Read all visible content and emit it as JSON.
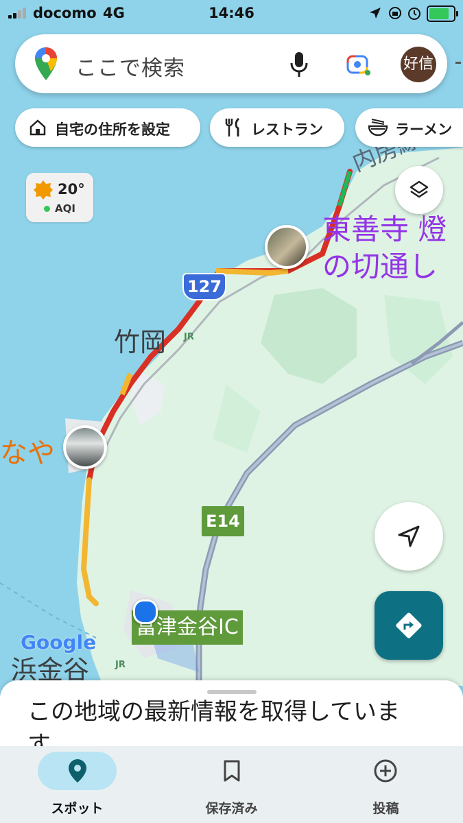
{
  "status_bar": {
    "carrier": "docomo",
    "network": "4G",
    "time": "14:46"
  },
  "search": {
    "placeholder": "ここで検索",
    "avatar_text": "好信"
  },
  "chips": [
    {
      "label": "自宅の住所を設定",
      "icon": "home-icon"
    },
    {
      "label": "レストラン",
      "icon": "restaurant-icon"
    },
    {
      "label": "ラーメン",
      "icon": "ramen-icon"
    }
  ],
  "weather": {
    "temperature": "20°",
    "aqi_label": "AQI"
  },
  "map": {
    "labels": {
      "line": "内房線",
      "poi_title_line1": "東善寺 燈",
      "poi_title_line2": "の切通し",
      "route_shield": "127",
      "town_takeoka": "竹岡",
      "partial_poi": "なや",
      "expressway": "E14",
      "interchange": "富津金谷IC",
      "google": "Google",
      "town_hamakanaya": "浜金谷",
      "jr": "JR"
    },
    "colors": {
      "sea": "#8fd3ea",
      "land": "#def3e4",
      "traffic_red": "#d93025",
      "traffic_orange": "#f2b631",
      "expressway_fill": "#9aa9be",
      "poi_purple": "#9334e6"
    }
  },
  "bottom_sheet": {
    "message": "この地域の最新情報を取得しています"
  },
  "nav": [
    {
      "label": "スポット",
      "icon": "pin-icon",
      "active": true
    },
    {
      "label": "保存済み",
      "icon": "bookmark-icon",
      "active": false
    },
    {
      "label": "投稿",
      "icon": "add-circle-icon",
      "active": false
    }
  ]
}
